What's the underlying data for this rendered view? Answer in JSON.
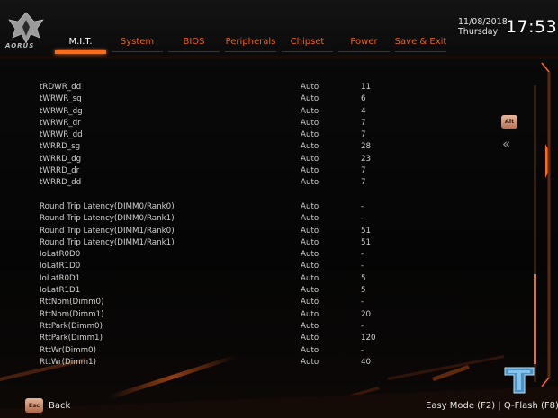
{
  "brand": {
    "logo_text": "AORUS"
  },
  "header": {
    "date": "11/08/2018",
    "weekday": "Thursday",
    "time": "17:53",
    "tabs": [
      {
        "label": "M.I.T.",
        "active": true
      },
      {
        "label": "System"
      },
      {
        "label": "BIOS"
      },
      {
        "label": "Peripherals"
      },
      {
        "label": "Chipset"
      },
      {
        "label": "Power"
      },
      {
        "label": "Save & Exit"
      }
    ]
  },
  "rows": [
    {
      "name": "tRDWR_dd",
      "mode": "Auto",
      "value": "11"
    },
    {
      "name": "tWRWR_sg",
      "mode": "Auto",
      "value": "6"
    },
    {
      "name": "tWRWR_dg",
      "mode": "Auto",
      "value": "4"
    },
    {
      "name": "tWRWR_dr",
      "mode": "Auto",
      "value": "7"
    },
    {
      "name": "tWRWR_dd",
      "mode": "Auto",
      "value": "7"
    },
    {
      "name": "tWRRD_sg",
      "mode": "Auto",
      "value": "28"
    },
    {
      "name": "tWRRD_dg",
      "mode": "Auto",
      "value": "23"
    },
    {
      "name": "tWRRD_dr",
      "mode": "Auto",
      "value": "7"
    },
    {
      "name": "tWRRD_dd",
      "mode": "Auto",
      "value": "7"
    },
    {
      "gap": true
    },
    {
      "name": "Round Trip Latency(DIMM0/Rank0)",
      "mode": "Auto",
      "value": "-"
    },
    {
      "name": "Round Trip Latency(DIMM0/Rank1)",
      "mode": "Auto",
      "value": "-"
    },
    {
      "name": "Round Trip Latency(DIMM1/Rank0)",
      "mode": "Auto",
      "value": "51"
    },
    {
      "name": "Round Trip Latency(DIMM1/Rank1)",
      "mode": "Auto",
      "value": "51"
    },
    {
      "name": "IoLatR0D0",
      "mode": "Auto",
      "value": "-"
    },
    {
      "name": "IoLatR1D0",
      "mode": "Auto",
      "value": "-"
    },
    {
      "name": "IoLatR0D1",
      "mode": "Auto",
      "value": "5"
    },
    {
      "name": "IoLatR1D1",
      "mode": "Auto",
      "value": "5"
    },
    {
      "name": "RttNom(Dimm0)",
      "mode": "Auto",
      "value": "-"
    },
    {
      "name": "RttNom(Dimm1)",
      "mode": "Auto",
      "value": "20"
    },
    {
      "name": "RttPark(Dimm0)",
      "mode": "Auto",
      "value": "-"
    },
    {
      "name": "RttPark(Dimm1)",
      "mode": "Auto",
      "value": "120"
    },
    {
      "name": "RttWr(Dimm0)",
      "mode": "Auto",
      "value": "-"
    },
    {
      "name": "RttWr(Dimm1)",
      "mode": "Auto",
      "value": "40"
    }
  ],
  "side": {
    "alt_label": "Alt",
    "collapse_glyph": "«"
  },
  "footer": {
    "esc_label": "Esc",
    "back_label": "Back",
    "easy_mode": "Easy Mode (F2)",
    "separator": "|",
    "qflash": "Q-Flash (F8)"
  },
  "colors": {
    "accent": "#ff6a1a",
    "tab_text": "#e8641e",
    "text": "#cfcfcf"
  },
  "icons": {
    "logo": "aorus-eagle-icon",
    "watermark": "tweaktown-logo-icon",
    "collapse": "double-chevron-left-icon"
  }
}
